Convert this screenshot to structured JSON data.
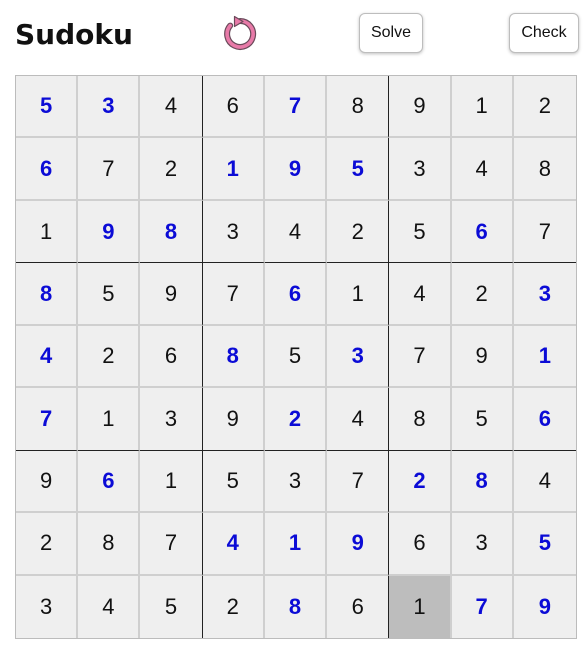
{
  "header": {
    "title": "Sudoku",
    "reset_icon": "refresh-icon",
    "reset_color": "#e87aa8",
    "solve_label": "Solve",
    "check_label": "Check"
  },
  "colors": {
    "given": "#0b0bd6",
    "filled": "#111111",
    "cell_bg": "#efefef",
    "selected_bg": "#bdbdbd"
  },
  "selected": {
    "row": 8,
    "col": 6
  },
  "grid": [
    [
      5,
      3,
      4,
      6,
      7,
      8,
      9,
      1,
      2
    ],
    [
      6,
      7,
      2,
      1,
      9,
      5,
      3,
      4,
      8
    ],
    [
      1,
      9,
      8,
      3,
      4,
      2,
      5,
      6,
      7
    ],
    [
      8,
      5,
      9,
      7,
      6,
      1,
      4,
      2,
      3
    ],
    [
      4,
      2,
      6,
      8,
      5,
      3,
      7,
      9,
      1
    ],
    [
      7,
      1,
      3,
      9,
      2,
      4,
      8,
      5,
      6
    ],
    [
      9,
      6,
      1,
      5,
      3,
      7,
      2,
      8,
      4
    ],
    [
      2,
      8,
      7,
      4,
      1,
      9,
      6,
      3,
      5
    ],
    [
      3,
      4,
      5,
      2,
      8,
      6,
      1,
      7,
      9
    ]
  ],
  "given": [
    [
      1,
      1,
      0,
      0,
      1,
      0,
      0,
      0,
      0
    ],
    [
      1,
      0,
      0,
      1,
      1,
      1,
      0,
      0,
      0
    ],
    [
      0,
      1,
      1,
      0,
      0,
      0,
      0,
      1,
      0
    ],
    [
      1,
      0,
      0,
      0,
      1,
      0,
      0,
      0,
      1
    ],
    [
      1,
      0,
      0,
      1,
      0,
      1,
      0,
      0,
      1
    ],
    [
      1,
      0,
      0,
      0,
      1,
      0,
      0,
      0,
      1
    ],
    [
      0,
      1,
      0,
      0,
      0,
      0,
      1,
      1,
      0
    ],
    [
      0,
      0,
      0,
      1,
      1,
      1,
      0,
      0,
      1
    ],
    [
      0,
      0,
      0,
      0,
      1,
      0,
      0,
      1,
      1
    ]
  ]
}
